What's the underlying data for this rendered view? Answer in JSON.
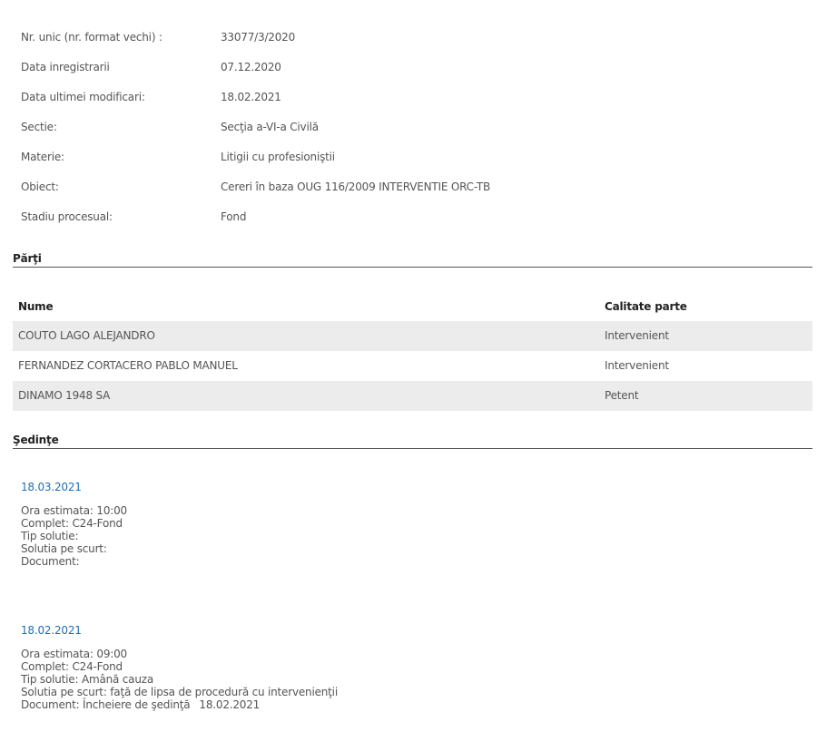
{
  "info": [
    {
      "label": "Nr. unic (nr. format vechi) :",
      "value": "33077/3/2020"
    },
    {
      "label": "Data inregistrarii",
      "value": "07.12.2020"
    },
    {
      "label": "Data ultimei modificari:",
      "value": "18.02.2021"
    },
    {
      "label": "Sectie:",
      "value": "Secţia a-VI-a Civilă"
    },
    {
      "label": "Materie:",
      "value": "Litigii cu profesioniştii"
    },
    {
      "label": "Obiect:",
      "value": "Cereri în baza OUG 116/2009 INTERVENTIE ORC-TB"
    },
    {
      "label": "Stadiu procesual:",
      "value": "Fond"
    }
  ],
  "parti": {
    "heading": "Părţi",
    "columns": {
      "name": "Nume",
      "role": "Calitate parte"
    },
    "rows": [
      {
        "name": "COUTO LAGO ALEJANDRO",
        "role": "Intervenient"
      },
      {
        "name": "FERNANDEZ CORTACERO PABLO MANUEL",
        "role": "Intervenient"
      },
      {
        "name": "DINAMO 1948 SA",
        "role": "Petent"
      }
    ]
  },
  "sedinte": {
    "heading": "Şedinţe",
    "items": [
      {
        "date": "18.03.2021",
        "ora": "Ora estimata: 10:00",
        "complet": "Complet: C24-Fond",
        "tip": "Tip solutie:",
        "solutia": "Solutia pe scurt:",
        "document": "Document:",
        "document_date": ""
      },
      {
        "date": "18.02.2021",
        "ora": "Ora estimata: 09:00",
        "complet": "Complet: C24-Fond",
        "tip": "Tip solutie: Amână cauza",
        "solutia": "Solutia pe scurt: faţă de lipsa de procedură cu intervenienţii",
        "document": "Document: Încheiere de şedinţă",
        "document_date": "18.02.2021"
      }
    ]
  }
}
